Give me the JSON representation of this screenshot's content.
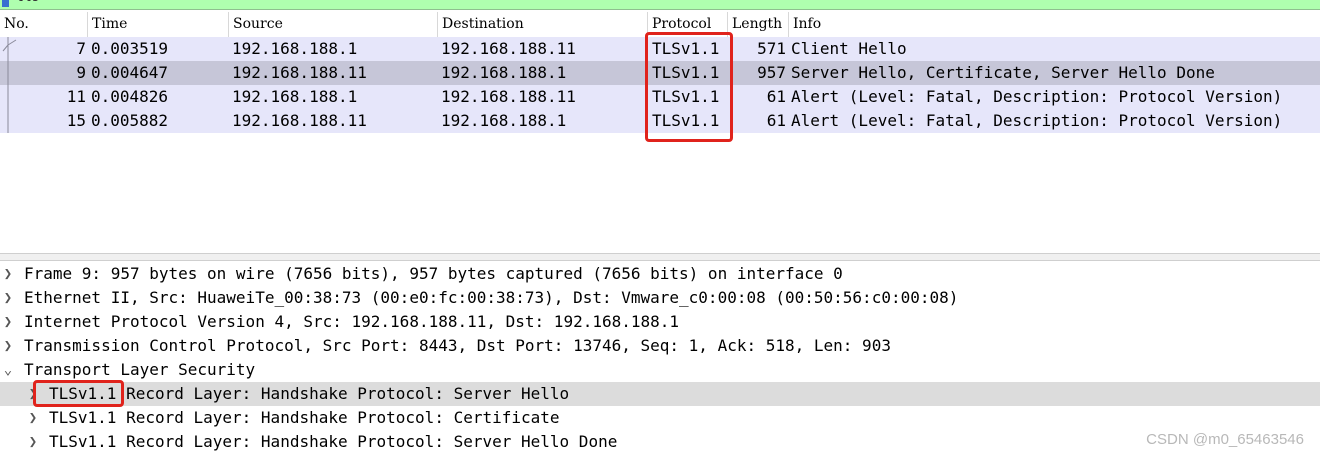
{
  "filter": {
    "text": "tls"
  },
  "packet_list": {
    "columns": [
      "No.",
      "Time",
      "Source",
      "Destination",
      "Protocol",
      "Length",
      "Info"
    ],
    "rows": [
      {
        "no": "7",
        "time": "0.003519",
        "source": "192.168.188.1",
        "destination": "192.168.188.11",
        "protocol": "TLSv1.1",
        "length": "571",
        "info": "Client Hello",
        "selected": false
      },
      {
        "no": "9",
        "time": "0.004647",
        "source": "192.168.188.11",
        "destination": "192.168.188.1",
        "protocol": "TLSv1.1",
        "length": "957",
        "info": "Server Hello, Certificate, Server Hello Done",
        "selected": true
      },
      {
        "no": "11",
        "time": "0.004826",
        "source": "192.168.188.1",
        "destination": "192.168.188.11",
        "protocol": "TLSv1.1",
        "length": "61",
        "info": "Alert (Level: Fatal, Description: Protocol Version)",
        "selected": false
      },
      {
        "no": "15",
        "time": "0.005882",
        "source": "192.168.188.11",
        "destination": "192.168.188.1",
        "protocol": "TLSv1.1",
        "length": "61",
        "info": "Alert (Level: Fatal, Description: Protocol Version)",
        "selected": false
      }
    ]
  },
  "details": {
    "items": [
      {
        "arrow": ">",
        "text": "Frame 9: 957 bytes on wire (7656 bits), 957 bytes captured (7656 bits) on interface 0",
        "level": 0
      },
      {
        "arrow": ">",
        "text": "Ethernet II, Src: HuaweiTe_00:38:73 (00:e0:fc:00:38:73), Dst: Vmware_c0:00:08 (00:50:56:c0:00:08)",
        "level": 0
      },
      {
        "arrow": ">",
        "text": "Internet Protocol Version 4, Src: 192.168.188.11, Dst: 192.168.188.1",
        "level": 0
      },
      {
        "arrow": ">",
        "text": "Transmission Control Protocol, Src Port: 8443, Dst Port: 13746, Seq: 1, Ack: 518, Len: 903",
        "level": 0
      },
      {
        "arrow": "v",
        "text": "Transport Layer Security",
        "level": 0
      },
      {
        "arrow": ">",
        "text": "TLSv1.1 Record Layer: Handshake Protocol: Server Hello",
        "level": 1,
        "selected": true
      },
      {
        "arrow": ">",
        "text": "TLSv1.1 Record Layer: Handshake Protocol: Certificate",
        "level": 1
      },
      {
        "arrow": ">",
        "text": "TLSv1.1 Record Layer: Handshake Protocol: Server Hello Done",
        "level": 1
      }
    ]
  },
  "watermark": "CSDN @m0_65463546",
  "colors": {
    "highlight": "#e0231c",
    "row_bg": "#e6e6fa",
    "row_selected": "#c6c6d8",
    "filter_bg": "#afffaf"
  }
}
